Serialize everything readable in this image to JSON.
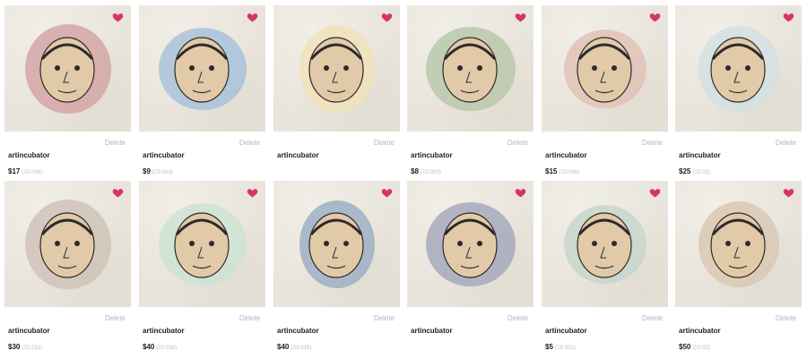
{
  "colors": {
    "heart": "#d6336c",
    "delete_text": "#b5b5b5",
    "eth_text": "#b9b9b9",
    "card_bg": "#e9e5dc"
  },
  "cards": [
    {
      "creator": "artincubator",
      "price": "$17",
      "eth": "(Ξ0.006)",
      "delete_label": "Delete",
      "favorited": true,
      "image_icon": "face-3d-glasses-art",
      "tint": "#d4a6a6"
    },
    {
      "creator": "artincubator",
      "price": "$9",
      "eth": "(Ξ0.003)",
      "delete_label": "Delete",
      "favorited": true,
      "image_icon": "face-horned-goggles-art",
      "tint": "#a9c2d9"
    },
    {
      "creator": "artincubator",
      "price": "",
      "eth": "",
      "delete_label": "Delete",
      "favorited": true,
      "image_icon": "face-mohawk-bowtie-art",
      "tint": "#eee3b8"
    },
    {
      "creator": "artincubator",
      "price": "$8",
      "eth": "(Ξ0.003)",
      "delete_label": "Delete",
      "favorited": true,
      "image_icon": "face-helmet-art",
      "tint": "#b9c8ac"
    },
    {
      "creator": "artincubator",
      "price": "$15",
      "eth": "(Ξ0.006)",
      "delete_label": "Delete",
      "favorited": true,
      "image_icon": "face-bearded-art",
      "tint": "#e2c2b6"
    },
    {
      "creator": "artincubator",
      "price": "$25",
      "eth": "(Ξ0.01)",
      "delete_label": "Delete",
      "favorited": true,
      "image_icon": "face-halo-afro-art",
      "tint": "#d2e0e3"
    },
    {
      "creator": "artincubator",
      "price": "$30",
      "eth": "(Ξ0.012)",
      "delete_label": "Delete",
      "favorited": true,
      "image_icon": "face-green-hair-art",
      "tint": "#cfc3b8"
    },
    {
      "creator": "artincubator",
      "price": "$40",
      "eth": "(Ξ0.016)",
      "delete_label": "Delete",
      "favorited": true,
      "image_icon": "face-curly-hair-art",
      "tint": "#cde3d3"
    },
    {
      "creator": "artincubator",
      "price": "$40",
      "eth": "(Ξ0.016)",
      "delete_label": "Delete",
      "favorited": true,
      "image_icon": "face-headband-antenna-art",
      "tint": "#9db0c4"
    },
    {
      "creator": "artincubator",
      "price": "",
      "eth": "",
      "delete_label": "Delete",
      "favorited": true,
      "image_icon": "face-halo-round-art",
      "tint": "#a6a9bd"
    },
    {
      "creator": "artincubator",
      "price": "$5",
      "eth": "(Ξ0.002)",
      "delete_label": "Delete",
      "favorited": true,
      "image_icon": "face-cap-art",
      "tint": "#c8d6cc"
    },
    {
      "creator": "artincubator",
      "price": "$50",
      "eth": "(Ξ0.02)",
      "delete_label": "Delete",
      "favorited": true,
      "image_icon": "face-glasses-sketch-art",
      "tint": "#d9c9b4"
    }
  ]
}
